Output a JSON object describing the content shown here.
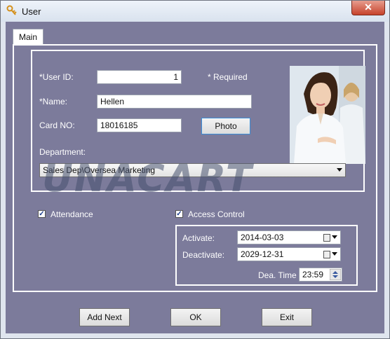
{
  "window": {
    "title": "User",
    "close_glyph": "✕"
  },
  "tabs": {
    "main": "Main"
  },
  "form": {
    "user_id_label": "*User ID:",
    "user_id_value": "1",
    "required_note": "* Required",
    "name_label": "*Name:",
    "name_value": "Hellen",
    "card_label": "Card NO:",
    "card_value": "18016185",
    "photo_button": "Photo",
    "department_label": "Department:",
    "department_value": "Sales Dep\\Oversea Marketing"
  },
  "watermark": "UNACART",
  "options": {
    "attendance_label": "Attendance",
    "attendance_checked": true,
    "access_label": "Access Control",
    "access_checked": true
  },
  "access": {
    "activate_label": "Activate:",
    "activate_value": "2014-03-03",
    "deactivate_label": "Deactivate:",
    "deactivate_value": "2029-12-31",
    "dea_time_label": "Dea. Time",
    "dea_time_value": "23:59"
  },
  "buttons": {
    "add_next": "Add Next",
    "ok": "OK",
    "exit": "Exit"
  },
  "icons": {
    "title": "user-key-icon",
    "calendar": "calendar-icon",
    "dropdown": "chevron-down-icon",
    "spin": "spin-updown-icon",
    "check": "check-icon"
  },
  "colors": {
    "panel_bg": "#7c7b9b",
    "close": "#c7432c"
  }
}
